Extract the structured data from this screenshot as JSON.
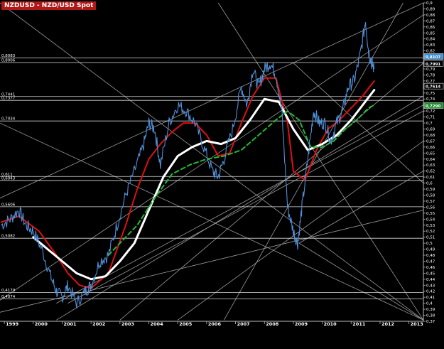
{
  "chart_data": {
    "type": "line",
    "title": "NZDUSD - NZD/USD Spot",
    "x_ticks": [
      "1999",
      "2000",
      "2001",
      "2002",
      "2003",
      "2004",
      "2005",
      "2006",
      "2007",
      "2008",
      "2009",
      "2010",
      "2011",
      "2012",
      "2013"
    ],
    "x_range": [
      1998.85,
      2013.5
    ],
    "ylim": [
      0.37,
      0.9
    ],
    "y_ticks": [
      0.37,
      0.38,
      0.39,
      0.4,
      0.41,
      0.42,
      0.43,
      0.44,
      0.45,
      0.46,
      0.47,
      0.48,
      0.49,
      0.5,
      0.51,
      0.52,
      0.53,
      0.54,
      0.55,
      0.56,
      0.57,
      0.58,
      0.59,
      0.6,
      0.61,
      0.62,
      0.63,
      0.64,
      0.65,
      0.66,
      0.67,
      0.68,
      0.69,
      0.7,
      0.71,
      0.72,
      0.73,
      0.74,
      0.75,
      0.76,
      0.77,
      0.78,
      0.79,
      0.8,
      0.81,
      0.82,
      0.83,
      0.84,
      0.85,
      0.86,
      0.87,
      0.88,
      0.89,
      0.9
    ],
    "y_tick_labels": [
      "0,37",
      "0,38",
      "0,39",
      "0,4",
      "0,41",
      "0,42",
      "0,43",
      "0,44",
      "0,45",
      "0,46",
      "0,47",
      "0,48",
      "0,49",
      "0,5",
      "0,51",
      "0,52",
      "0,53",
      "0,54",
      "0,55",
      "0,56",
      "0,57",
      "0,58",
      "0,59",
      "0,6",
      "0,61",
      "0,62",
      "0,63",
      "0,64",
      "0,65",
      "0,66",
      "0,67",
      "0,68",
      "0,69",
      "0,7",
      "0,71",
      "0,72",
      "0,73",
      "0,74",
      "0,75",
      "0,76",
      "0,77",
      "0,78",
      "0,79",
      "0,8",
      "0,81",
      "0,82",
      "0,83",
      "0,84",
      "0,85",
      "0,86",
      "0,87",
      "0,88",
      "0,89",
      "0,9"
    ],
    "grid": false,
    "price_series": {
      "x": [
        1998.9,
        1999.2,
        1999.5,
        1999.75,
        2000.0,
        2000.3,
        2000.6,
        2000.8,
        2001.0,
        2001.2,
        2001.5,
        2001.8,
        2002.0,
        2002.3,
        2002.6,
        2002.9,
        2003.2,
        2003.5,
        2003.8,
        2004.0,
        2004.2,
        2004.4,
        2004.7,
        2005.0,
        2005.3,
        2005.6,
        2005.9,
        2006.2,
        2006.4,
        2006.6,
        2006.9,
        2007.2,
        2007.4,
        2007.6,
        2007.8,
        2008.0,
        2008.2,
        2008.4,
        2008.6,
        2008.8,
        2009.0,
        2009.15,
        2009.3,
        2009.5,
        2009.7,
        2009.9,
        2010.1,
        2010.3,
        2010.5,
        2010.7,
        2010.9,
        2011.1,
        2011.3,
        2011.5,
        2011.6,
        2011.7,
        2011.8
      ],
      "values": [
        0.53,
        0.54,
        0.555,
        0.53,
        0.52,
        0.49,
        0.445,
        0.42,
        0.41,
        0.43,
        0.4,
        0.42,
        0.43,
        0.47,
        0.48,
        0.53,
        0.58,
        0.62,
        0.66,
        0.7,
        0.69,
        0.63,
        0.7,
        0.73,
        0.72,
        0.7,
        0.66,
        0.62,
        0.61,
        0.64,
        0.69,
        0.76,
        0.73,
        0.79,
        0.76,
        0.79,
        0.8,
        0.78,
        0.72,
        0.56,
        0.52,
        0.5,
        0.56,
        0.64,
        0.72,
        0.7,
        0.7,
        0.67,
        0.7,
        0.72,
        0.76,
        0.77,
        0.81,
        0.87,
        0.82,
        0.8,
        0.79
      ],
      "color": "#4f8fd8"
    },
    "moving_averages": [
      {
        "x": [
          1998.9,
          1999.5,
          2000.2,
          2000.8,
          2001.2,
          2001.6,
          2002.0,
          2002.6,
          2003.2,
          2003.6,
          2004.0,
          2004.4,
          2004.8,
          2005.2,
          2005.6,
          2006.0,
          2006.4,
          2006.8,
          2007.2,
          2007.6,
          2008.0,
          2008.4,
          2008.8,
          2009.0,
          2009.4,
          2009.8,
          2010.2,
          2010.6,
          2011.0,
          2011.4,
          2011.8
        ],
        "values": [
          0.535,
          0.545,
          0.52,
          0.48,
          0.45,
          0.43,
          0.425,
          0.45,
          0.53,
          0.59,
          0.64,
          0.665,
          0.685,
          0.7,
          0.7,
          0.68,
          0.645,
          0.65,
          0.7,
          0.745,
          0.775,
          0.775,
          0.7,
          0.62,
          0.605,
          0.655,
          0.69,
          0.705,
          0.725,
          0.745,
          0.77
        ],
        "color": "#e01010",
        "style": "solid",
        "width": 2
      },
      {
        "x": [
          2000.0,
          2000.5,
          2001.0,
          2001.5,
          2002.0,
          2002.5,
          2003.0,
          2003.5,
          2004.0,
          2004.5,
          2005.0,
          2005.5,
          2006.0,
          2006.5,
          2007.0,
          2007.5,
          2008.0,
          2008.5,
          2009.0,
          2009.5,
          2010.0,
          2010.5,
          2011.0,
          2011.4,
          2011.8
        ],
        "values": [
          0.51,
          0.49,
          0.47,
          0.45,
          0.44,
          0.445,
          0.47,
          0.5,
          0.555,
          0.61,
          0.645,
          0.66,
          0.67,
          0.665,
          0.675,
          0.705,
          0.74,
          0.735,
          0.69,
          0.655,
          0.665,
          0.68,
          0.705,
          0.73,
          0.755
        ],
        "color": "#ffffff",
        "style": "solid",
        "width": 3
      },
      {
        "x": [
          2002.6,
          2003.0,
          2003.6,
          2004.2,
          2004.8,
          2005.4,
          2006.0,
          2006.6,
          2007.2,
          2007.8,
          2008.4,
          2008.8,
          2009.2,
          2009.6,
          2010.0,
          2010.4,
          2010.8,
          2011.2,
          2011.6,
          2011.8
        ],
        "values": [
          0.48,
          0.5,
          0.53,
          0.575,
          0.615,
          0.63,
          0.64,
          0.645,
          0.655,
          0.68,
          0.705,
          0.72,
          0.705,
          0.66,
          0.66,
          0.67,
          0.69,
          0.705,
          0.725,
          0.73
        ],
        "color": "#22bb33",
        "style": "dashed",
        "width": 2
      }
    ],
    "horizontal_levels": [
      {
        "value": 0.8083,
        "label": "0,8083"
      },
      {
        "value": 0.8006,
        "label": "0,8006"
      },
      {
        "value": 0.7441,
        "label": "0,7441"
      },
      {
        "value": 0.7377,
        "label": "0,7377"
      },
      {
        "value": 0.7034,
        "label": "0,7034"
      },
      {
        "value": 0.611,
        "label": "0,611"
      },
      {
        "value": 0.6043,
        "label": "0,6043"
      },
      {
        "value": 0.5606,
        "label": "0,5606"
      },
      {
        "value": 0.5082,
        "label": "0,5082"
      },
      {
        "value": 0.4179,
        "label": "0,4179"
      },
      {
        "value": 0.4074,
        "label": "0,4074"
      }
    ],
    "price_tags": [
      {
        "value": 0.8107,
        "label": "0,8107",
        "bg": "#3d8fd0"
      },
      {
        "value": 0.7991,
        "label": "0,7991",
        "bg": "#000000"
      },
      {
        "value": 0.7614,
        "label": "0,7614",
        "bg": "#000000"
      },
      {
        "value": 0.729,
        "label": "0,7290",
        "bg": "#1f8f2e"
      }
    ],
    "trendlines": [
      {
        "x": [
          1998.85,
          2013.5
        ],
        "y": [
          0.9,
          0.372
        ]
      },
      {
        "x": [
          1998.85,
          2013.5
        ],
        "y": [
          0.7,
          0.372
        ]
      },
      {
        "x": [
          1998.85,
          2013.5
        ],
        "y": [
          0.575,
          0.9
        ]
      },
      {
        "x": [
          1998.85,
          2013.5
        ],
        "y": [
          0.405,
          0.88
        ]
      },
      {
        "x": [
          1998.85,
          2013.5
        ],
        "y": [
          0.385,
          0.555
        ]
      },
      {
        "x": [
          2000.8,
          2013.5
        ],
        "y": [
          0.4,
          0.73
        ]
      },
      {
        "x": [
          2001.2,
          2013.5
        ],
        "y": [
          0.4,
          0.72
        ]
      },
      {
        "x": [
          2000.8,
          2013.5
        ],
        "y": [
          0.372,
          0.745
        ]
      },
      {
        "x": [
          2003.0,
          2013.5
        ],
        "y": [
          0.372,
          0.8
        ]
      },
      {
        "x": [
          2006.6,
          2012.8
        ],
        "y": [
          0.372,
          0.9
        ]
      },
      {
        "x": [
          2006.4,
          2013.5
        ],
        "y": [
          0.9,
          0.372
        ]
      },
      {
        "x": [
          2009.2,
          2013.5
        ],
        "y": [
          0.5,
          0.372
        ]
      },
      {
        "x": [
          2009.2,
          2013.5
        ],
        "y": [
          0.5,
          0.62
        ]
      },
      {
        "x": [
          2005.0,
          2013.5
        ],
        "y": [
          0.372,
          0.67
        ]
      },
      {
        "x": [
          2009.0,
          2013.5
        ],
        "y": [
          0.8,
          0.6
        ]
      }
    ]
  }
}
